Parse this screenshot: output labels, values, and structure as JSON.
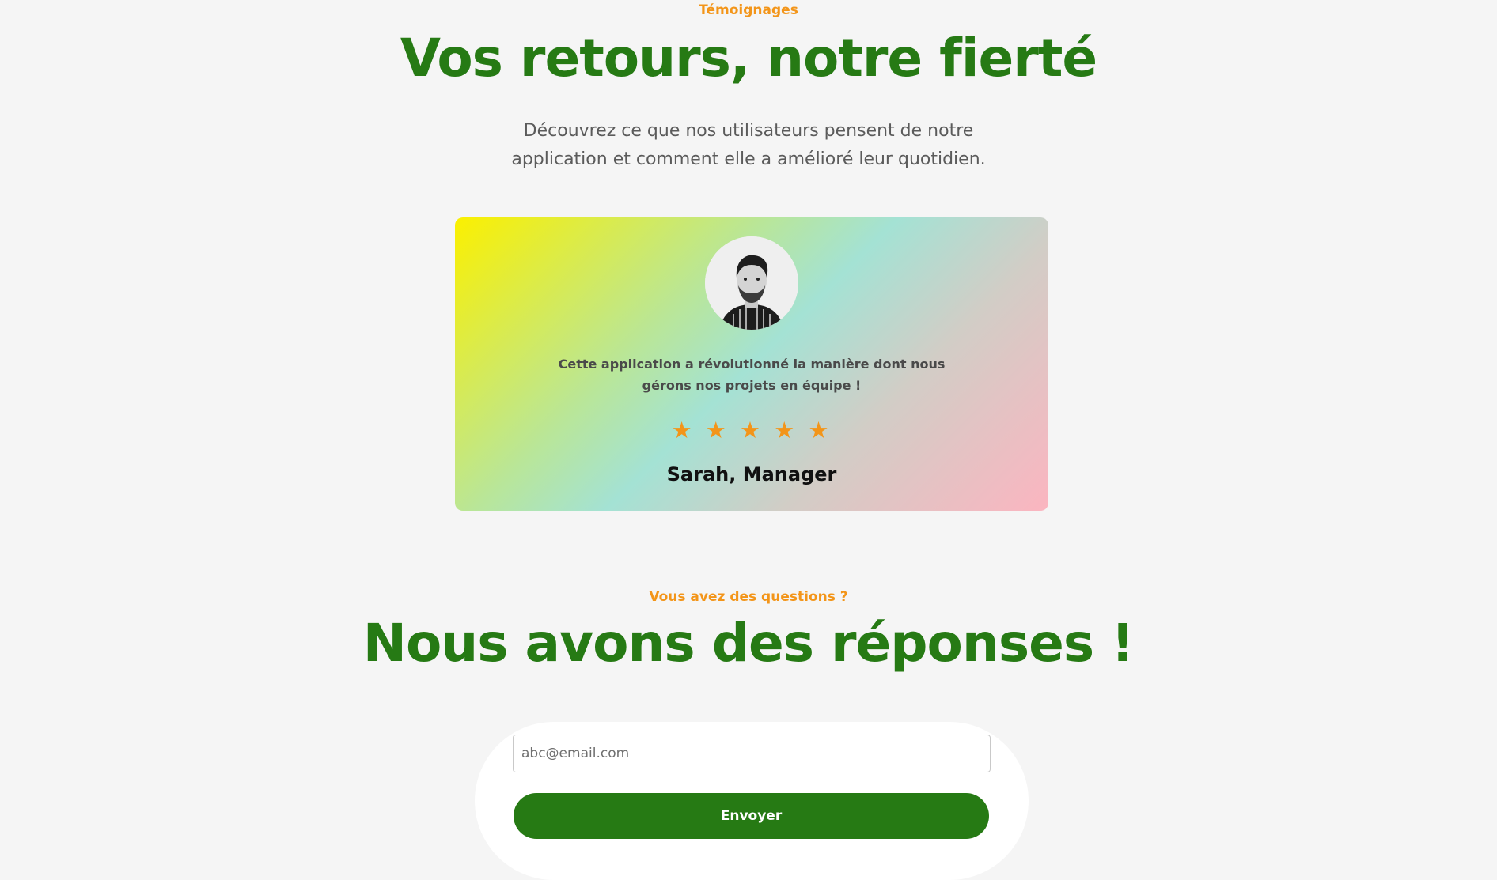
{
  "testimonials": {
    "eyebrow": "Témoignages",
    "title": "Vos retours, notre fierté",
    "subtitle": "Découvrez ce que nos utilisateurs pensent de notre application et comment elle a amélioré leur quotidien.",
    "card": {
      "quote": "Cette application a révolutionné la manière dont nous gérons nos projets en équipe !",
      "rating": 5,
      "rating_max": 5,
      "star_glyph": "★",
      "author": "Sarah, Manager",
      "avatar_icon": "person-portrait"
    }
  },
  "faq": {
    "eyebrow": "Vous avez des questions ?",
    "title": "Nous avons des réponses !"
  },
  "form": {
    "email_placeholder": "abc@email.com",
    "email_value": "",
    "submit_label": "Envoyer"
  },
  "colors": {
    "background": "#f5f5f5",
    "accent_orange": "#f39519",
    "brand_green": "#267a14"
  }
}
